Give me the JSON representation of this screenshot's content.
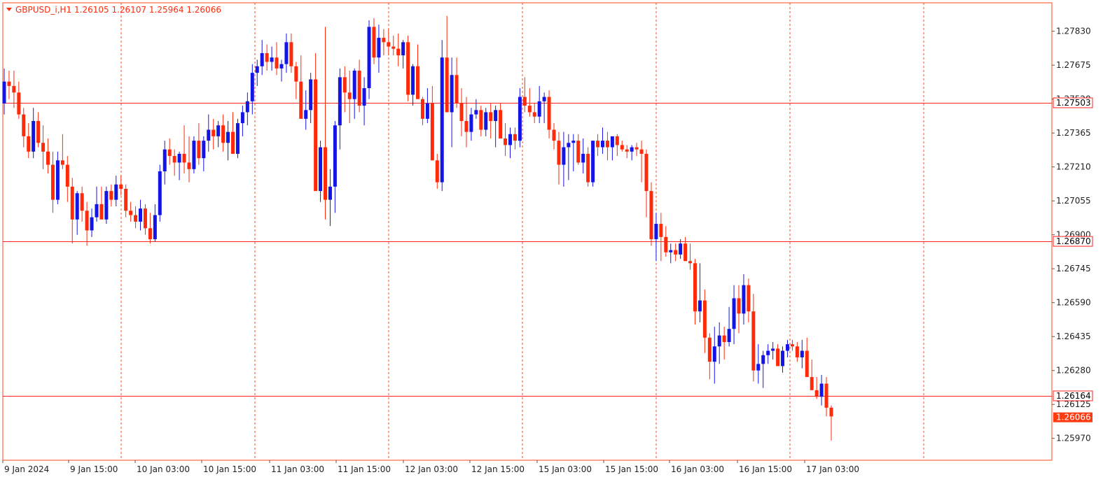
{
  "window": {
    "symbol_info": "GBPUSD_i,H1  1.26105 1.26107 1.25964 1.26066"
  },
  "colors": {
    "up": "#1414e6",
    "down": "#ff2a0a",
    "frame": "#ff4a1a",
    "level_line": "#ff2020",
    "text": "#222222",
    "current_price_label": "#ff3a10"
  },
  "chart_data": {
    "type": "candlestick",
    "symbol": "GBPUSD_i",
    "timeframe": "H1",
    "ylim": [
      1.2587,
      1.2796
    ],
    "grid": "vertical dashed lines at 15:00 and 03:00 sessions",
    "y_ticks": [
      "1.27830",
      "1.27675",
      "1.27520",
      "1.27365",
      "1.27210",
      "1.27055",
      "1.26900",
      "1.26745",
      "1.26590",
      "1.26435",
      "1.26280",
      "1.26125",
      "1.25970"
    ],
    "x_ticks": [
      "9 Jan 2024",
      "9 Jan 15:00",
      "10 Jan 03:00",
      "10 Jan 15:00",
      "11 Jan 03:00",
      "11 Jan 15:00",
      "12 Jan 03:00",
      "12 Jan 15:00",
      "15 Jan 03:00",
      "15 Jan 15:00",
      "16 Jan 03:00",
      "16 Jan 15:00",
      "17 Jan 03:00"
    ],
    "levels": [
      {
        "value": 1.27503,
        "label": "1.27503"
      },
      {
        "value": 1.2687,
        "label": "1.26870"
      },
      {
        "value": 1.26164,
        "label": "1.26164"
      }
    ],
    "current_price": {
      "value": 1.26066,
      "label": "1.26066"
    },
    "ohlc": [
      [
        1.275,
        1.2766,
        1.2745,
        1.276
      ],
      [
        1.276,
        1.2765,
        1.2752,
        1.2758
      ],
      [
        1.2758,
        1.2765,
        1.2748,
        1.2755
      ],
      [
        1.2755,
        1.276,
        1.2743,
        1.2745
      ],
      [
        1.2745,
        1.2748,
        1.273,
        1.2735
      ],
      [
        1.2735,
        1.2741,
        1.2725,
        1.2728
      ],
      [
        1.2728,
        1.2748,
        1.2725,
        1.2742
      ],
      [
        1.2742,
        1.2746,
        1.273,
        1.2732
      ],
      [
        1.2732,
        1.274,
        1.272,
        1.2728
      ],
      [
        1.2728,
        1.2734,
        1.2718,
        1.2722
      ],
      [
        1.2722,
        1.2728,
        1.27,
        1.2706
      ],
      [
        1.2706,
        1.2728,
        1.2704,
        1.2724
      ],
      [
        1.2724,
        1.2736,
        1.272,
        1.2722
      ],
      [
        1.2722,
        1.2726,
        1.2705,
        1.2712
      ],
      [
        1.2712,
        1.2716,
        1.2686,
        1.2697
      ],
      [
        1.2697,
        1.271,
        1.269,
        1.2709
      ],
      [
        1.2709,
        1.2712,
        1.2696,
        1.2701
      ],
      [
        1.2701,
        1.2705,
        1.2685,
        1.2692
      ],
      [
        1.2692,
        1.2702,
        1.2689,
        1.2698
      ],
      [
        1.2698,
        1.2712,
        1.2696,
        1.2704
      ],
      [
        1.2704,
        1.2712,
        1.2698,
        1.2697
      ],
      [
        1.2697,
        1.2712,
        1.2695,
        1.271
      ],
      [
        1.271,
        1.2713,
        1.2703,
        1.2706
      ],
      [
        1.2706,
        1.2717,
        1.2703,
        1.2713
      ],
      [
        1.2713,
        1.2717,
        1.2708,
        1.2711
      ],
      [
        1.2711,
        1.2713,
        1.2698,
        1.2701
      ],
      [
        1.2701,
        1.2705,
        1.2696,
        1.2699
      ],
      [
        1.2699,
        1.2703,
        1.2693,
        1.2696
      ],
      [
        1.2696,
        1.2706,
        1.2692,
        1.2702
      ],
      [
        1.2702,
        1.2704,
        1.269,
        1.2693
      ],
      [
        1.2693,
        1.27,
        1.2686,
        1.2688
      ],
      [
        1.2688,
        1.2704,
        1.2687,
        1.2699
      ],
      [
        1.2699,
        1.2722,
        1.2696,
        1.2719
      ],
      [
        1.2719,
        1.2733,
        1.2713,
        1.2729
      ],
      [
        1.2729,
        1.2734,
        1.2722,
        1.2726
      ],
      [
        1.2726,
        1.2729,
        1.2717,
        1.2723
      ],
      [
        1.2723,
        1.2728,
        1.2715,
        1.2727
      ],
      [
        1.2727,
        1.274,
        1.2718,
        1.2723
      ],
      [
        1.2723,
        1.2735,
        1.2714,
        1.272
      ],
      [
        1.272,
        1.2735,
        1.2718,
        1.2733
      ],
      [
        1.2733,
        1.2741,
        1.2722,
        1.2725
      ],
      [
        1.2725,
        1.2735,
        1.2719,
        1.2733
      ],
      [
        1.2733,
        1.2745,
        1.2728,
        1.2738
      ],
      [
        1.2738,
        1.2743,
        1.2729,
        1.2735
      ],
      [
        1.2735,
        1.2742,
        1.273,
        1.274
      ],
      [
        1.274,
        1.2745,
        1.2728,
        1.2732
      ],
      [
        1.2732,
        1.2742,
        1.2724,
        1.2737
      ],
      [
        1.2737,
        1.2746,
        1.273,
        1.2727
      ],
      [
        1.2727,
        1.2743,
        1.2725,
        1.2741
      ],
      [
        1.2741,
        1.2749,
        1.2735,
        1.2746
      ],
      [
        1.2746,
        1.2755,
        1.274,
        1.2751
      ],
      [
        1.2751,
        1.2768,
        1.2745,
        1.2764
      ],
      [
        1.2764,
        1.277,
        1.2758,
        1.2767
      ],
      [
        1.2767,
        1.2779,
        1.2763,
        1.2773
      ],
      [
        1.2773,
        1.2777,
        1.2765,
        1.2769
      ],
      [
        1.2769,
        1.2776,
        1.2765,
        1.2771
      ],
      [
        1.2771,
        1.2778,
        1.2763,
        1.2766
      ],
      [
        1.2766,
        1.277,
        1.276,
        1.2768
      ],
      [
        1.2768,
        1.2782,
        1.2764,
        1.2778
      ],
      [
        1.2778,
        1.2782,
        1.2764,
        1.2767
      ],
      [
        1.2767,
        1.2769,
        1.2752,
        1.276
      ],
      [
        1.276,
        1.2772,
        1.2745,
        1.2743
      ],
      [
        1.2743,
        1.2756,
        1.2738,
        1.2747
      ],
      [
        1.2747,
        1.2764,
        1.2741,
        1.2761
      ],
      [
        1.2761,
        1.2773,
        1.275,
        1.271
      ],
      [
        1.271,
        1.2733,
        1.2705,
        1.273
      ],
      [
        1.273,
        1.2785,
        1.2697,
        1.2706
      ],
      [
        1.2706,
        1.272,
        1.2694,
        1.2712
      ],
      [
        1.2712,
        1.2742,
        1.27,
        1.274
      ],
      [
        1.274,
        1.2766,
        1.2729,
        1.2762
      ],
      [
        1.2762,
        1.2767,
        1.2746,
        1.2755
      ],
      [
        1.2755,
        1.2765,
        1.2741,
        1.2752
      ],
      [
        1.2752,
        1.2766,
        1.2743,
        1.2765
      ],
      [
        1.2765,
        1.277,
        1.2746,
        1.2749
      ],
      [
        1.2749,
        1.2762,
        1.274,
        1.2757
      ],
      [
        1.2757,
        1.2788,
        1.2752,
        1.2785
      ],
      [
        1.2785,
        1.2789,
        1.2768,
        1.2771
      ],
      [
        1.2771,
        1.2786,
        1.2764,
        1.278
      ],
      [
        1.278,
        1.2784,
        1.2772,
        1.2778
      ],
      [
        1.2778,
        1.2784,
        1.2772,
        1.2776
      ],
      [
        1.2776,
        1.2781,
        1.2772,
        1.2775
      ],
      [
        1.2775,
        1.2782,
        1.2767,
        1.2772
      ],
      [
        1.2772,
        1.2779,
        1.2766,
        1.2778
      ],
      [
        1.2778,
        1.2781,
        1.2751,
        1.2754
      ],
      [
        1.2754,
        1.2768,
        1.2749,
        1.2767
      ],
      [
        1.2767,
        1.2777,
        1.2753,
        1.2752
      ],
      [
        1.2752,
        1.2753,
        1.274,
        1.2743
      ],
      [
        1.2743,
        1.2757,
        1.2741,
        1.275
      ],
      [
        1.275,
        1.2758,
        1.2741,
        1.2724
      ],
      [
        1.2724,
        1.2727,
        1.2711,
        1.2714
      ],
      [
        1.2714,
        1.2779,
        1.271,
        1.2771
      ],
      [
        1.2771,
        1.279,
        1.276,
        1.2746
      ],
      [
        1.2746,
        1.2771,
        1.273,
        1.2763
      ],
      [
        1.2763,
        1.2771,
        1.2748,
        1.275
      ],
      [
        1.275,
        1.2757,
        1.2735,
        1.2742
      ],
      [
        1.2742,
        1.2753,
        1.273,
        1.2737
      ],
      [
        1.2737,
        1.2748,
        1.2733,
        1.2745
      ],
      [
        1.2745,
        1.2752,
        1.2743,
        1.2747
      ],
      [
        1.2747,
        1.2749,
        1.2735,
        1.2738
      ],
      [
        1.2738,
        1.2748,
        1.2735,
        1.2746
      ],
      [
        1.2746,
        1.275,
        1.2734,
        1.2742
      ],
      [
        1.2742,
        1.2749,
        1.273,
        1.2747
      ],
      [
        1.2747,
        1.275,
        1.2735,
        1.2734
      ],
      [
        1.2734,
        1.2741,
        1.2726,
        1.2731
      ],
      [
        1.2731,
        1.2739,
        1.2725,
        1.2736
      ],
      [
        1.2736,
        1.2739,
        1.2729,
        1.2733
      ],
      [
        1.2733,
        1.2757,
        1.273,
        1.2753
      ],
      [
        1.2753,
        1.2762,
        1.2746,
        1.2749
      ],
      [
        1.2749,
        1.2757,
        1.2744,
        1.2746
      ],
      [
        1.2746,
        1.275,
        1.2741,
        1.2744
      ],
      [
        1.2744,
        1.2758,
        1.2741,
        1.2751
      ],
      [
        1.2751,
        1.2755,
        1.2741,
        1.2753
      ],
      [
        1.2753,
        1.2756,
        1.2734,
        1.2738
      ],
      [
        1.2738,
        1.2741,
        1.2729,
        1.2733
      ],
      [
        1.2733,
        1.2737,
        1.2713,
        1.2722
      ],
      [
        1.2722,
        1.2737,
        1.2712,
        1.273
      ],
      [
        1.273,
        1.2736,
        1.2715,
        1.2732
      ],
      [
        1.2732,
        1.2736,
        1.2719,
        1.2733
      ],
      [
        1.2733,
        1.2736,
        1.2722,
        1.2723
      ],
      [
        1.2723,
        1.2734,
        1.2718,
        1.2727
      ],
      [
        1.2727,
        1.273,
        1.2712,
        1.2714
      ],
      [
        1.2714,
        1.2725,
        1.2712,
        1.2733
      ],
      [
        1.2733,
        1.2736,
        1.2726,
        1.273
      ],
      [
        1.273,
        1.2739,
        1.2727,
        1.2733
      ],
      [
        1.2733,
        1.2737,
        1.2724,
        1.273
      ],
      [
        1.273,
        1.2734,
        1.2724,
        1.2735
      ],
      [
        1.2735,
        1.2736,
        1.2726,
        1.2731
      ],
      [
        1.2731,
        1.2733,
        1.2728,
        1.2729
      ],
      [
        1.2729,
        1.2731,
        1.2725,
        1.2728
      ],
      [
        1.2728,
        1.2731,
        1.2724,
        1.273
      ],
      [
        1.273,
        1.2732,
        1.2726,
        1.2729
      ],
      [
        1.2729,
        1.2733,
        1.2714,
        1.2727
      ],
      [
        1.2727,
        1.2729,
        1.2698,
        1.271
      ],
      [
        1.271,
        1.2714,
        1.2685,
        1.2688
      ],
      [
        1.2688,
        1.27,
        1.2678,
        1.2695
      ],
      [
        1.2695,
        1.27,
        1.2678,
        1.2689
      ],
      [
        1.2689,
        1.2694,
        1.268,
        1.2682
      ],
      [
        1.2682,
        1.2686,
        1.2677,
        1.2683
      ],
      [
        1.2683,
        1.2686,
        1.2678,
        1.2681
      ],
      [
        1.2681,
        1.2688,
        1.2679,
        1.2686
      ],
      [
        1.2686,
        1.2689,
        1.2679,
        1.2678
      ],
      [
        1.2678,
        1.2686,
        1.2674,
        1.2677
      ],
      [
        1.2677,
        1.2679,
        1.2649,
        1.2655
      ],
      [
        1.2655,
        1.2677,
        1.265,
        1.266
      ],
      [
        1.266,
        1.2665,
        1.2636,
        1.2643
      ],
      [
        1.2643,
        1.2645,
        1.2624,
        1.2632
      ],
      [
        1.2632,
        1.2648,
        1.2622,
        1.2639
      ],
      [
        1.2639,
        1.265,
        1.2631,
        1.2644
      ],
      [
        1.2644,
        1.2648,
        1.2633,
        1.2641
      ],
      [
        1.2641,
        1.2657,
        1.2639,
        1.2647
      ],
      [
        1.2647,
        1.2667,
        1.264,
        1.2661
      ],
      [
        1.2661,
        1.2667,
        1.2645,
        1.2654
      ],
      [
        1.2654,
        1.2672,
        1.2649,
        1.2667
      ],
      [
        1.2667,
        1.267,
        1.265,
        1.2655
      ],
      [
        1.2655,
        1.2663,
        1.2623,
        1.2628
      ],
      [
        1.2628,
        1.264,
        1.2622,
        1.2631
      ],
      [
        1.2631,
        1.2637,
        1.262,
        1.2635
      ],
      [
        1.2635,
        1.264,
        1.2631,
        1.2637
      ],
      [
        1.2637,
        1.2641,
        1.2633,
        1.2638
      ],
      [
        1.2638,
        1.264,
        1.2632,
        1.263
      ],
      [
        1.263,
        1.2639,
        1.2627,
        1.2637
      ],
      [
        1.2637,
        1.2642,
        1.2634,
        1.264
      ],
      [
        1.264,
        1.2642,
        1.2637,
        1.2639
      ],
      [
        1.2639,
        1.2641,
        1.2632,
        1.2634
      ],
      [
        1.2634,
        1.2642,
        1.2629,
        1.2637
      ],
      [
        1.2637,
        1.2643,
        1.2634,
        1.2625
      ],
      [
        1.2625,
        1.2633,
        1.262,
        1.2619
      ],
      [
        1.2619,
        1.2625,
        1.2615,
        1.2616
      ],
      [
        1.2616,
        1.2626,
        1.2612,
        1.2622
      ],
      [
        1.2622,
        1.2625,
        1.2607,
        1.2611
      ],
      [
        1.2611,
        1.2612,
        1.2596,
        1.2607
      ]
    ]
  }
}
